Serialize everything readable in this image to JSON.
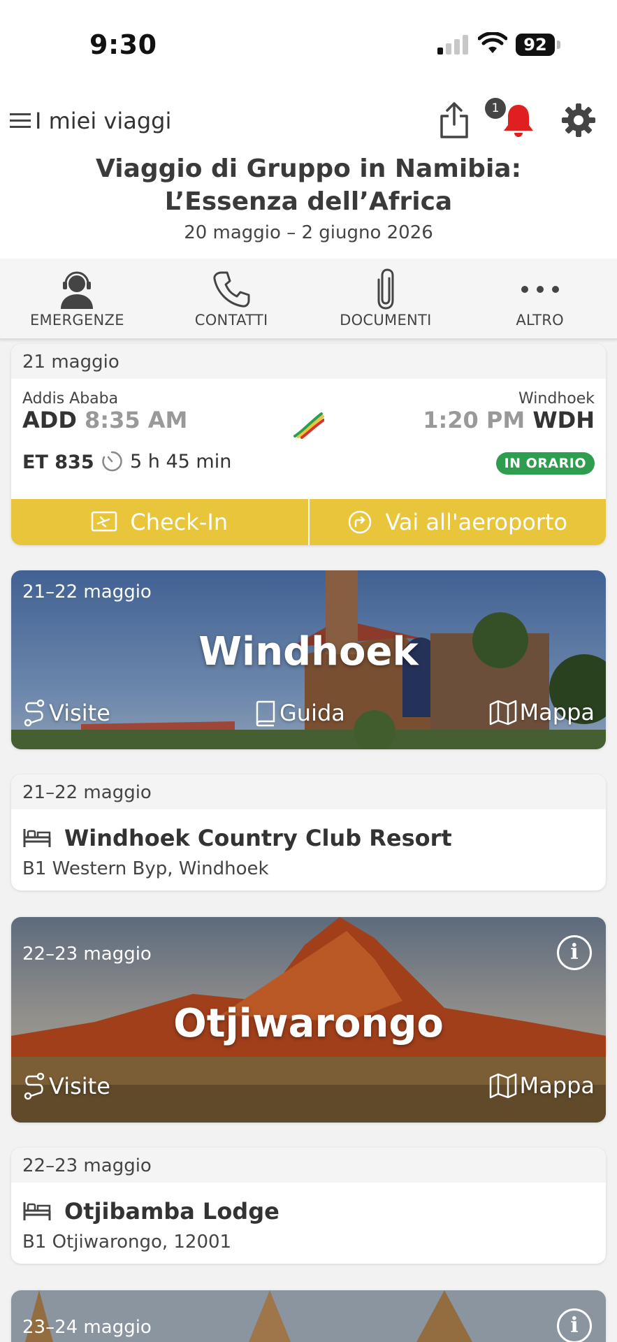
{
  "status_bar": {
    "time": "9:30",
    "battery": "92"
  },
  "header": {
    "menu_label": "I miei viaggi",
    "notification_count": "1",
    "trip_title": "Viaggio di Gruppo in Namibia: L’Essenza dell’Africa",
    "trip_dates": "20 maggio – 2 giugno 2026"
  },
  "toolbar": {
    "items": [
      {
        "label": "EMERGENZE",
        "icon": "headset-agent-icon"
      },
      {
        "label": "CONTATTI",
        "icon": "phone-icon"
      },
      {
        "label": "DOCUMENTI",
        "icon": "paperclip-icon"
      },
      {
        "label": "ALTRO",
        "icon": "more-dots-icon"
      }
    ]
  },
  "flight": {
    "date": "21 maggio",
    "from_city": "Addis Ababa",
    "from_code": "ADD",
    "depart_time": "8:35 AM",
    "to_city": "Windhoek",
    "to_code": "WDH",
    "arrive_time": "1:20 PM",
    "number": "ET 835",
    "duration": "5 h 45 min",
    "status": "IN ORARIO",
    "checkin_label": "Check-In",
    "airport_label": "Vai all'aeroporto",
    "colors": {
      "button": "#e8c53b",
      "status": "#2e9e4e"
    }
  },
  "stops": [
    {
      "date": "21–22 maggio",
      "city": "Windhoek",
      "links": {
        "visits": "Visite",
        "guide": "Guida",
        "map": "Mappa"
      }
    },
    {
      "date": "22–23 maggio",
      "city": "Otjiwarongo",
      "links": {
        "visits": "Visite",
        "map": "Mappa"
      }
    },
    {
      "date": "23–24 maggio"
    }
  ],
  "hotels": [
    {
      "date": "21–22 maggio",
      "name": "Windhoek Country Club Resort",
      "address": "B1 Western Byp, Windhoek"
    },
    {
      "date": "22–23 maggio",
      "name": "Otjibamba Lodge",
      "address": "B1 Otjiwarongo, 12001"
    }
  ]
}
